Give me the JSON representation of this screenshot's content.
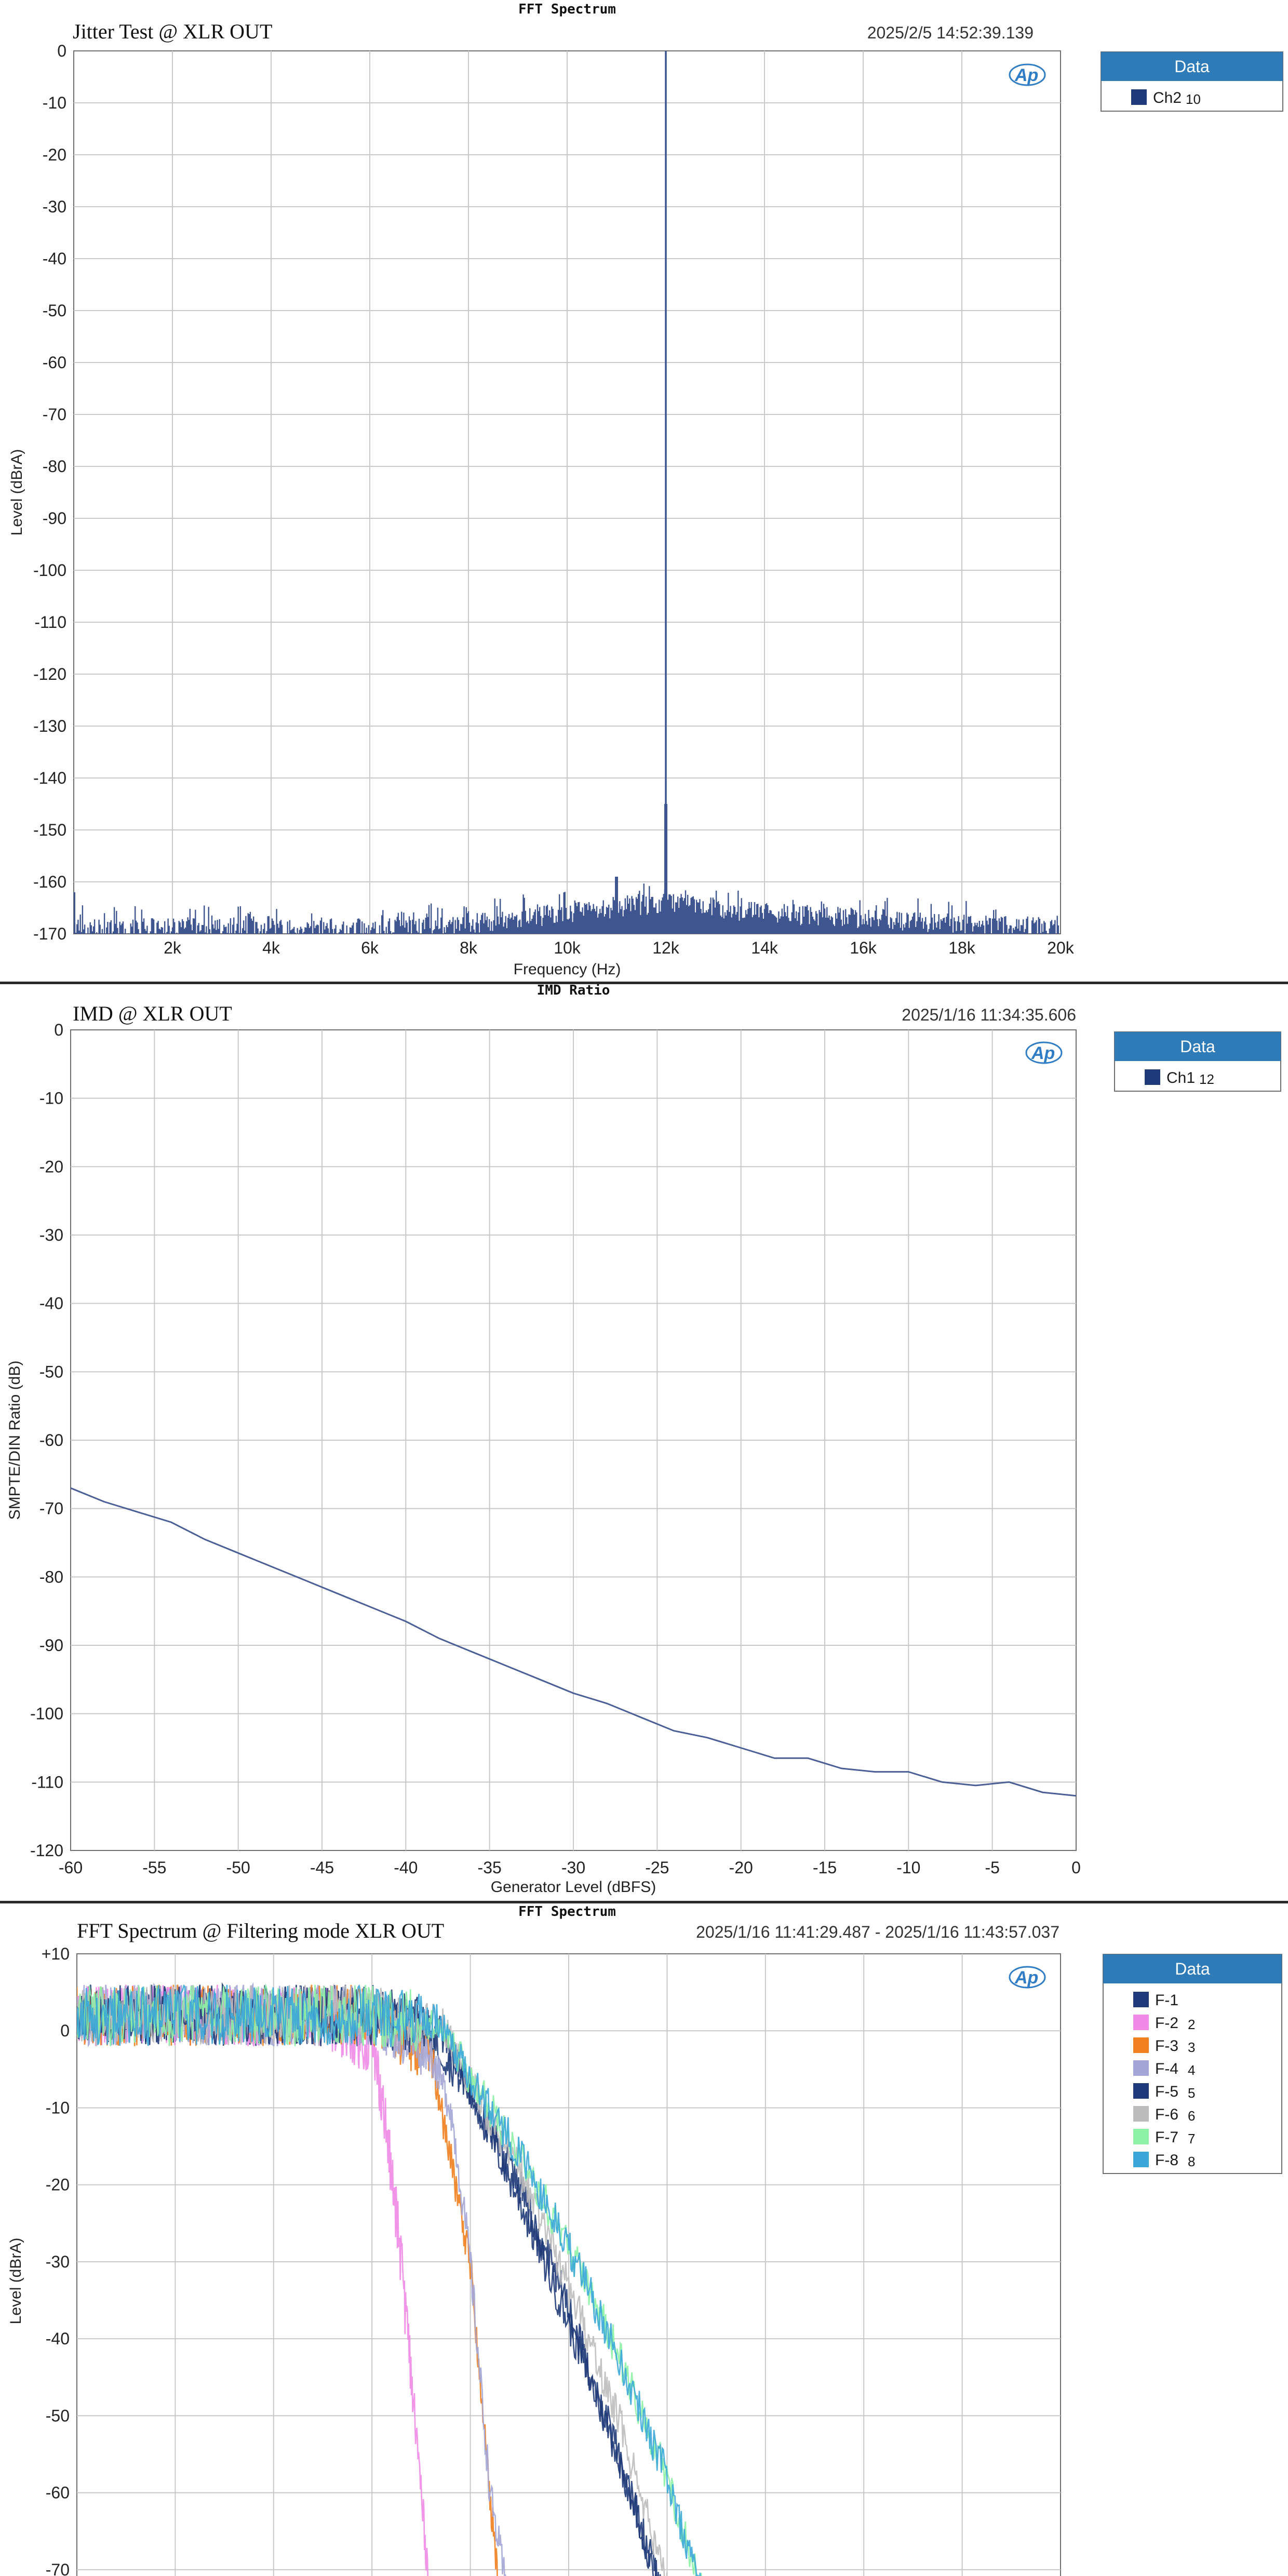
{
  "chart_data": [
    {
      "type": "line",
      "sup_title": "FFT Spectrum",
      "title": "Jitter Test @ XLR OUT",
      "timestamp": "2025/2/5 14:52:39.139",
      "xlabel": "Frequency (Hz)",
      "ylabel": "Level (dBrA)",
      "xlim": [
        0,
        20000
      ],
      "ylim": [
        -170,
        0
      ],
      "x_ticks": [
        2000,
        4000,
        6000,
        8000,
        10000,
        12000,
        14000,
        16000,
        18000,
        20000
      ],
      "x_tick_labels": [
        "2k",
        "4k",
        "6k",
        "8k",
        "10k",
        "12k",
        "14k",
        "16k",
        "18k",
        "20k"
      ],
      "y_ticks": [
        0,
        -10,
        -20,
        -30,
        -40,
        -50,
        -60,
        -70,
        -80,
        -90,
        -100,
        -110,
        -120,
        -130,
        -140,
        -150,
        -160,
        -170
      ],
      "y_tick_labels": [
        "0",
        "-10",
        "-20",
        "-30",
        "-40",
        "-50",
        "-60",
        "-70",
        "-80",
        "-90",
        "-100",
        "-110",
        "-120",
        "-130",
        "-140",
        "-150",
        "-160",
        "-170"
      ],
      "grid": true,
      "legend": {
        "header": "Data",
        "placement": "right",
        "entries": [
          {
            "name": "Ch2",
            "number": "10",
            "color": "#1f3a78"
          }
        ]
      },
      "series": [
        {
          "name": "Ch2",
          "color": "#3e5590",
          "noise_floor": {
            "x": [
              0,
              2000,
              4000,
              6000,
              8000,
              10000,
              11000,
              12000,
              13000,
              14000,
              16000,
              18000,
              20000
            ],
            "y": [
              -167,
              -167,
              -167,
              -167,
              -166,
              -164,
              -163,
              -162,
              -163,
              -164,
              -165,
              -166,
              -167
            ]
          },
          "peaks": [
            {
              "x": 12000,
              "y": 0
            },
            {
              "x": 12000,
              "y": -145
            },
            {
              "x": 11000,
              "y": -159
            },
            {
              "x": 0,
              "y": -162
            }
          ]
        }
      ]
    },
    {
      "type": "line",
      "sup_title": "IMD Ratio",
      "title": "IMD @ XLR OUT",
      "timestamp": "2025/1/16 11:34:35.606",
      "xlabel": "Generator Level (dBFS)",
      "ylabel": "SMPTE/DIN Ratio (dB)",
      "xlim": [
        -60,
        0
      ],
      "ylim": [
        -120,
        0
      ],
      "x_ticks": [
        -60,
        -55,
        -50,
        -45,
        -40,
        -35,
        -30,
        -25,
        -20,
        -15,
        -10,
        -5,
        0
      ],
      "x_tick_labels": [
        "-60",
        "-55",
        "-50",
        "-45",
        "-40",
        "-35",
        "-30",
        "-25",
        "-20",
        "-15",
        "-10",
        "-5",
        "0"
      ],
      "y_ticks": [
        0,
        -10,
        -20,
        -30,
        -40,
        -50,
        -60,
        -70,
        -80,
        -90,
        -100,
        -110,
        -120
      ],
      "y_tick_labels": [
        "0",
        "-10",
        "-20",
        "-30",
        "-40",
        "-50",
        "-60",
        "-70",
        "-80",
        "-90",
        "-100",
        "-110",
        "-120"
      ],
      "grid": true,
      "legend": {
        "header": "Data",
        "placement": "right",
        "entries": [
          {
            "name": "Ch1",
            "number": "12",
            "color": "#1f3a78"
          }
        ]
      },
      "series": [
        {
          "name": "Ch1",
          "color": "#4a5f95",
          "x": [
            -60,
            -58,
            -56,
            -54,
            -52,
            -50,
            -48,
            -46,
            -44,
            -42,
            -40,
            -38,
            -36,
            -34,
            -32,
            -30,
            -28,
            -26,
            -24,
            -22,
            -20,
            -18,
            -16,
            -14,
            -12,
            -10,
            -8,
            -6,
            -4,
            -2,
            0
          ],
          "y": [
            -67,
            -69,
            -70.5,
            -72,
            -74.5,
            -76.5,
            -78.5,
            -80.5,
            -82.5,
            -84.5,
            -86.5,
            -89,
            -91,
            -93,
            -95,
            -97,
            -98.5,
            -100.5,
            -102.5,
            -103.5,
            -105,
            -106.5,
            -106.5,
            -108,
            -108.5,
            -108.5,
            -110,
            -110.5,
            -110,
            -111.5,
            -112
          ]
        }
      ]
    },
    {
      "type": "line",
      "sup_title": "FFT Spectrum",
      "title": "FFT Spectrum @ Filtering mode XLR OUT",
      "timestamp": "2025/1/16 11:41:29.487 - 2025/1/16 11:43:57.037",
      "xlabel": "",
      "ylabel": "Level (dBrA)",
      "xlim": [
        0,
        1
      ],
      "ylim": [
        -75,
        10
      ],
      "y_ticks": [
        10,
        0,
        -10,
        -20,
        -30,
        -40,
        -50,
        -60,
        -70
      ],
      "y_tick_labels": [
        "+10",
        "0",
        "-10",
        "-20",
        "-30",
        "-40",
        "-50",
        "-60",
        "-70"
      ],
      "x_grid_count": 10,
      "grid": true,
      "legend": {
        "header": "Data",
        "placement": "right",
        "entries": [
          {
            "name": "F-1",
            "number": "",
            "color": "#1f3a78"
          },
          {
            "name": "F-2",
            "number": "2",
            "color": "#f08ae6"
          },
          {
            "name": "F-3",
            "number": "3",
            "color": "#f07f1e"
          },
          {
            "name": "F-4",
            "number": "4",
            "color": "#a3a6d6"
          },
          {
            "name": "F-5",
            "number": "5",
            "color": "#1f3a78"
          },
          {
            "name": "F-6",
            "number": "6",
            "color": "#bcbcbc"
          },
          {
            "name": "F-7",
            "number": "7",
            "color": "#8df2a6"
          },
          {
            "name": "F-8",
            "number": "8",
            "color": "#3aa7d8"
          }
        ]
      },
      "series": [
        {
          "name": "F-1",
          "color": "#1f3a78",
          "x": [
            0,
            0.3,
            0.35,
            0.4,
            0.45,
            0.5,
            0.55,
            0.6
          ],
          "y": [
            2,
            2,
            1,
            -8,
            -22,
            -38,
            -55,
            -75
          ]
        },
        {
          "name": "F-2",
          "color": "#f08ae6",
          "x": [
            0,
            0.25,
            0.3,
            0.31,
            0.33,
            0.35,
            0.36
          ],
          "y": [
            2,
            2,
            -2,
            -8,
            -30,
            -60,
            -75
          ]
        },
        {
          "name": "F-3",
          "color": "#f07f1e",
          "x": [
            0,
            0.3,
            0.36,
            0.37,
            0.4,
            0.42,
            0.43
          ],
          "y": [
            2,
            2,
            -3,
            -10,
            -30,
            -60,
            -75
          ]
        },
        {
          "name": "F-4",
          "color": "#a3a6d6",
          "x": [
            0,
            0.3,
            0.36,
            0.38,
            0.4,
            0.42,
            0.44
          ],
          "y": [
            2,
            2,
            -3,
            -10,
            -30,
            -60,
            -75
          ]
        },
        {
          "name": "F-5",
          "color": "#1f3a78",
          "x": [
            0,
            0.3,
            0.37,
            0.4,
            0.45,
            0.5,
            0.55,
            0.6
          ],
          "y": [
            2,
            2,
            0,
            -8,
            -20,
            -36,
            -55,
            -75
          ]
        },
        {
          "name": "F-6",
          "color": "#bcbcbc",
          "x": [
            0,
            0.3,
            0.37,
            0.4,
            0.45,
            0.5,
            0.55,
            0.6
          ],
          "y": [
            2,
            2,
            1,
            -7,
            -18,
            -33,
            -50,
            -72
          ]
        },
        {
          "name": "F-7",
          "color": "#8df2a6",
          "x": [
            0,
            0.3,
            0.37,
            0.4,
            0.45,
            0.5,
            0.55,
            0.6,
            0.64
          ],
          "y": [
            2,
            2,
            1,
            -6,
            -16,
            -28,
            -42,
            -58,
            -75
          ]
        },
        {
          "name": "F-8",
          "color": "#3aa7d8",
          "x": [
            0,
            0.3,
            0.37,
            0.4,
            0.45,
            0.5,
            0.55,
            0.6,
            0.64
          ],
          "y": [
            2,
            2,
            1,
            -6,
            -16,
            -28,
            -42,
            -58,
            -75
          ]
        }
      ]
    }
  ]
}
